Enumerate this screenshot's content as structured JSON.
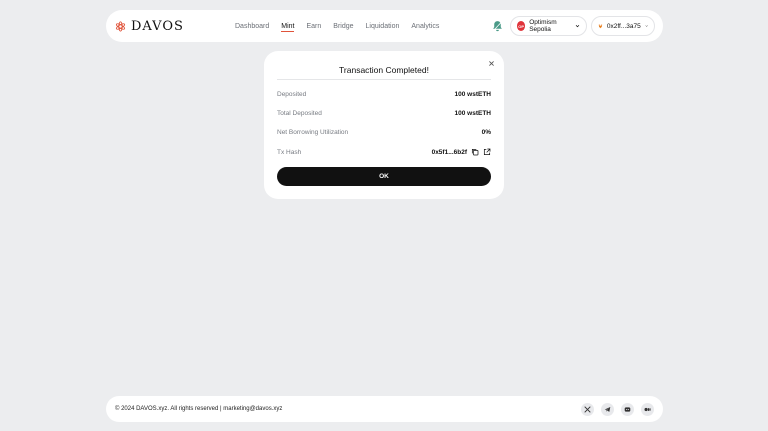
{
  "brand": {
    "name": "DAVOS",
    "accent": "#e0533a"
  },
  "nav": {
    "items": [
      {
        "label": "Dashboard"
      },
      {
        "label": "Mint"
      },
      {
        "label": "Earn"
      },
      {
        "label": "Bridge"
      },
      {
        "label": "Liquidation"
      },
      {
        "label": "Analytics"
      }
    ],
    "active": "Mint"
  },
  "network": {
    "badge": "OP",
    "label": "Optimism Sepolia"
  },
  "wallet": {
    "address": "0x2ff...3a75"
  },
  "modal": {
    "title": "Transaction Completed!",
    "rows": [
      {
        "label": "Deposited",
        "value": "100 wstETH"
      },
      {
        "label": "Total Deposited",
        "value": "100 wstETH"
      },
      {
        "label": "Net Borrowing Utilization",
        "value": "0%"
      },
      {
        "label": "Tx Hash",
        "value": "0x5f1...6b2f"
      }
    ],
    "ok_label": "OK"
  },
  "footer": {
    "copyright": "© 2024 DAVOS.xyz. All rights reserved | marketing@davos.xyz",
    "socials": [
      "x-icon",
      "telegram-icon",
      "discord-icon",
      "medium-icon"
    ]
  }
}
